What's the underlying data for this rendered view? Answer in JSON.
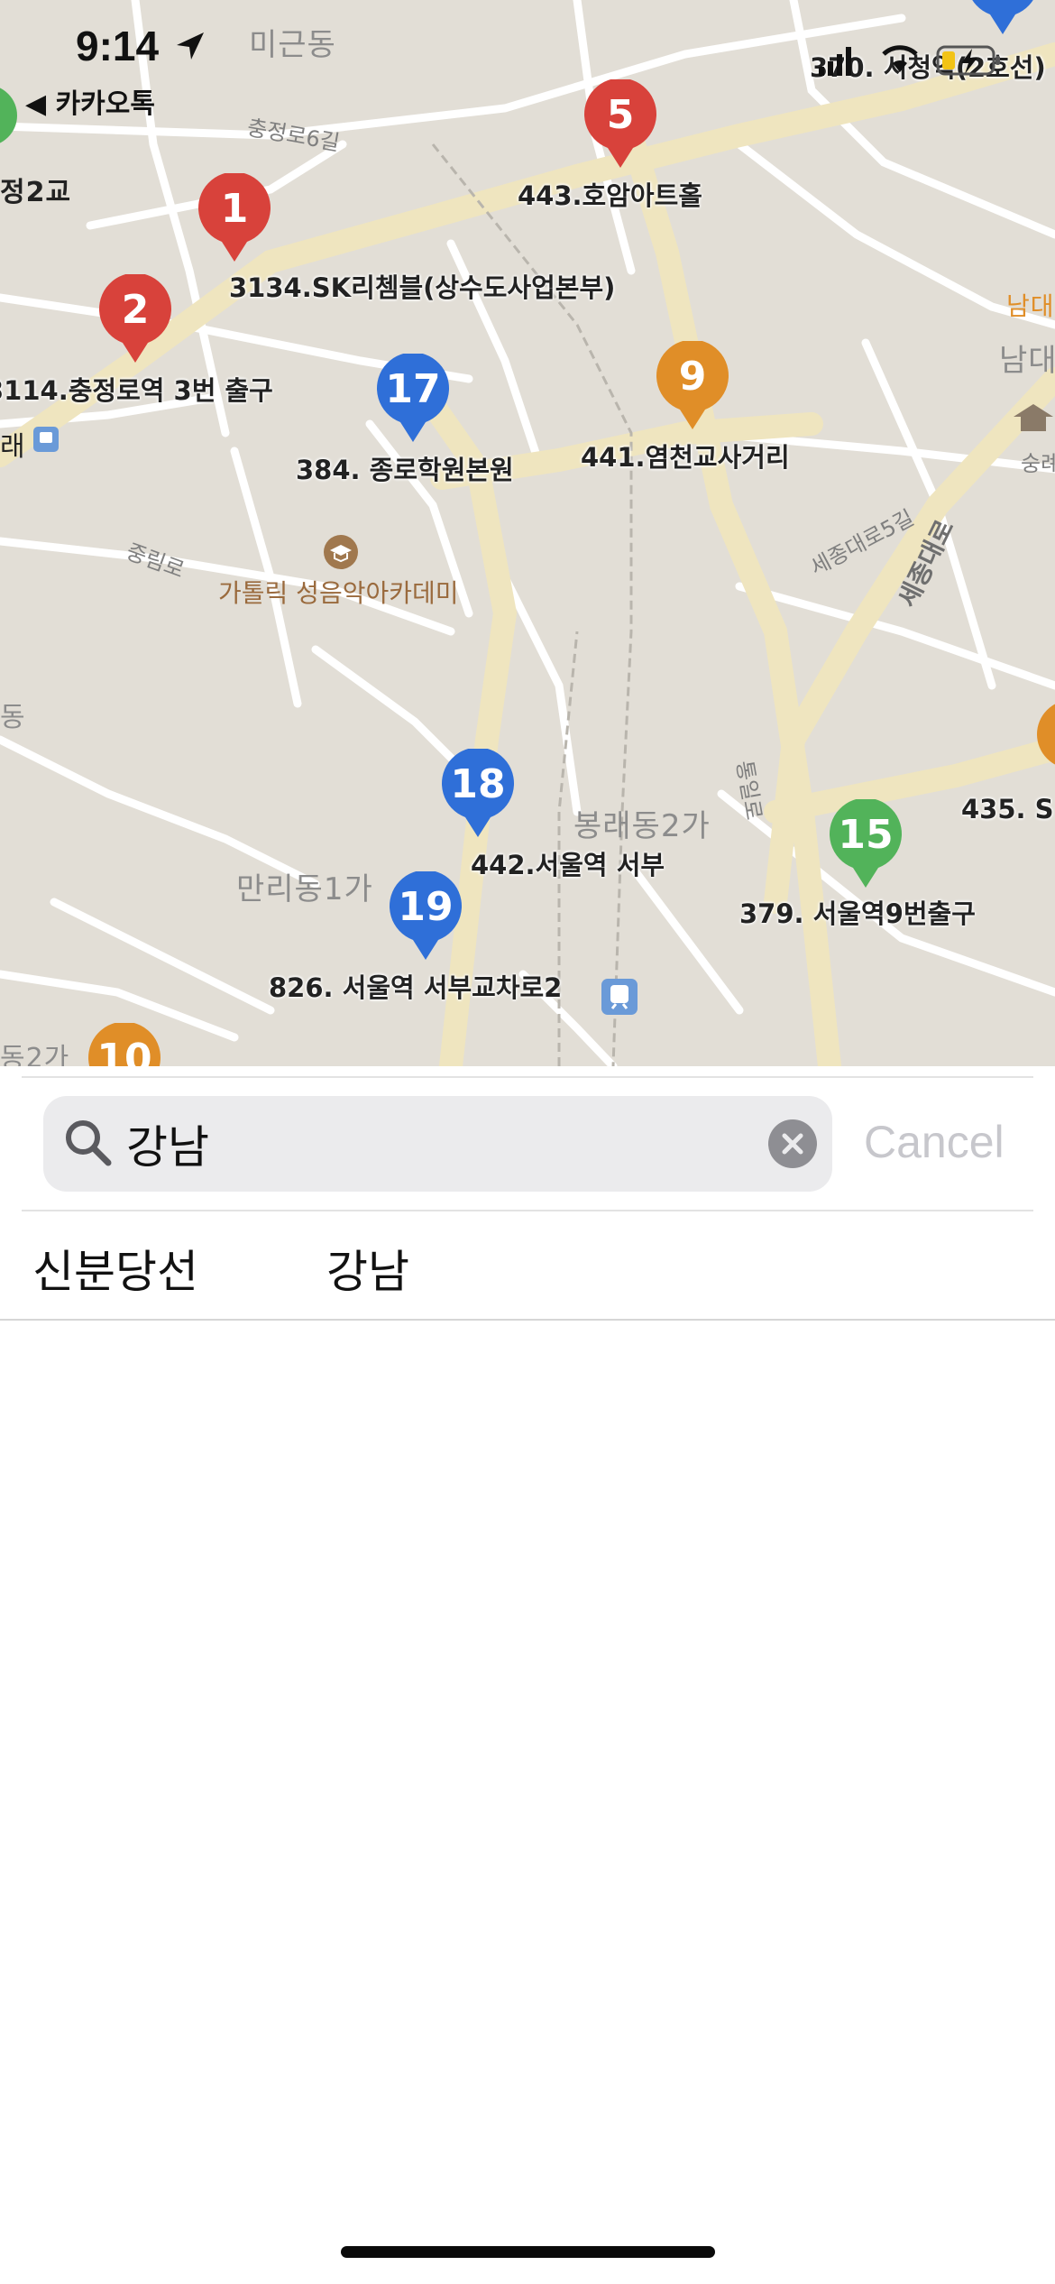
{
  "status_bar": {
    "time": "9:14",
    "back_app": "◀ 카카오톡"
  },
  "map": {
    "districts": [
      "미근동",
      "봉래동2가",
      "만리동1가",
      "남대",
      "정2교",
      "래",
      "동",
      "동2가"
    ],
    "road_names": [
      "충정로6길",
      "중림로",
      "세종대로5길",
      "세종대로",
      "통일로"
    ],
    "poi": "가톨릭 성음악아카데미",
    "pins": [
      {
        "num": "1",
        "color": "#d8423b",
        "label": "3134.SK리쳄블(상수도사업본부)"
      },
      {
        "num": "2",
        "color": "#d8423b",
        "label": "3114.충정로역 3번 출구"
      },
      {
        "num": "5",
        "color": "#d8423b",
        "label": "443.호암아트홀"
      },
      {
        "num": "9",
        "color": "#e08e28",
        "label": "441.염천교사거리"
      },
      {
        "num": "17",
        "color": "#2f6fd8",
        "label": "384. 종로학원본원"
      },
      {
        "num": "18",
        "color": "#2f6fd8",
        "label": "442.서울역 서부"
      },
      {
        "num": "19",
        "color": "#2f6fd8",
        "label": "826. 서울역 서부교차로2"
      },
      {
        "num": "15",
        "color": "#52b35a",
        "label": "379. 서울역9번출구"
      },
      {
        "num": "10",
        "color": "#e08e28",
        "label": ""
      }
    ],
    "edge_labels": [
      "370. 서청역(2호선)",
      "435. S",
      "남대",
      "숭례"
    ]
  },
  "search": {
    "query": "강남",
    "cancel_label": "Cancel"
  },
  "results": [
    {
      "line": "신분당선",
      "name": "강남"
    }
  ]
}
